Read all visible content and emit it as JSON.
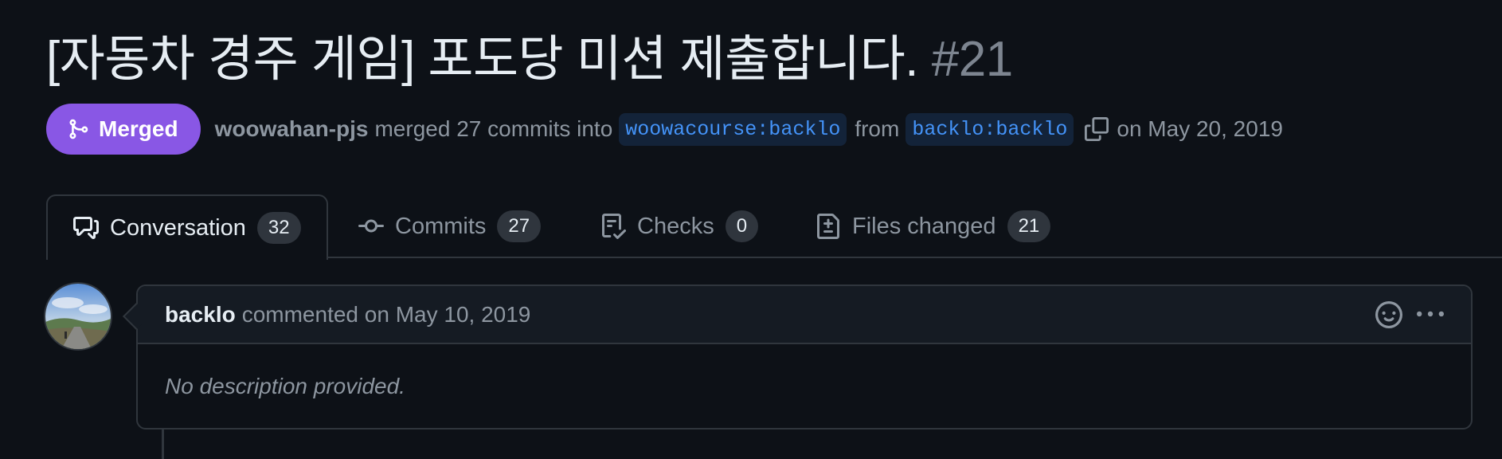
{
  "pr": {
    "title": "[자동차 경주 게임] 포도당 미션 제출합니다.",
    "number": "#21",
    "state_label": "Merged",
    "merger": "woowahan-pjs",
    "merge_text_1": "merged 27 commits into",
    "base_branch": "woowacourse:backlo",
    "merge_text_2": "from",
    "head_branch": "backlo:backlo",
    "merge_date": "on May 20, 2019"
  },
  "tabs": [
    {
      "label": "Conversation",
      "count": "32",
      "icon": "comment-discussion-icon"
    },
    {
      "label": "Commits",
      "count": "27",
      "icon": "git-commit-icon"
    },
    {
      "label": "Checks",
      "count": "0",
      "icon": "checklist-icon"
    },
    {
      "label": "Files changed",
      "count": "21",
      "icon": "file-diff-icon"
    }
  ],
  "comment": {
    "author": "backlo",
    "action": "commented on May 10, 2019",
    "body": "No description provided."
  },
  "colors": {
    "background": "#0d1117",
    "merged": "#8957e5",
    "branch_text": "#4493f8",
    "border": "#30363d"
  }
}
